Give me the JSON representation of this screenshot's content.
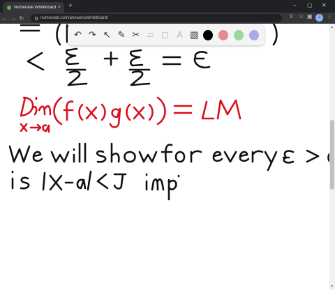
{
  "browser": {
    "tab_title": "Numerade Whiteboard",
    "tab_close": "×",
    "new_tab": "+",
    "url": "numerade.com/answers/whiteboard/",
    "profile_initial": "J",
    "minimize": "–",
    "close": "✕"
  },
  "toolbar": {
    "colors": [
      "#000000",
      "#e8899a",
      "#9dd89a",
      "#a9a9f0"
    ]
  },
  "whiteboard": {
    "ink_colors": {
      "black": "#111111",
      "red": "#d8101e"
    }
  }
}
